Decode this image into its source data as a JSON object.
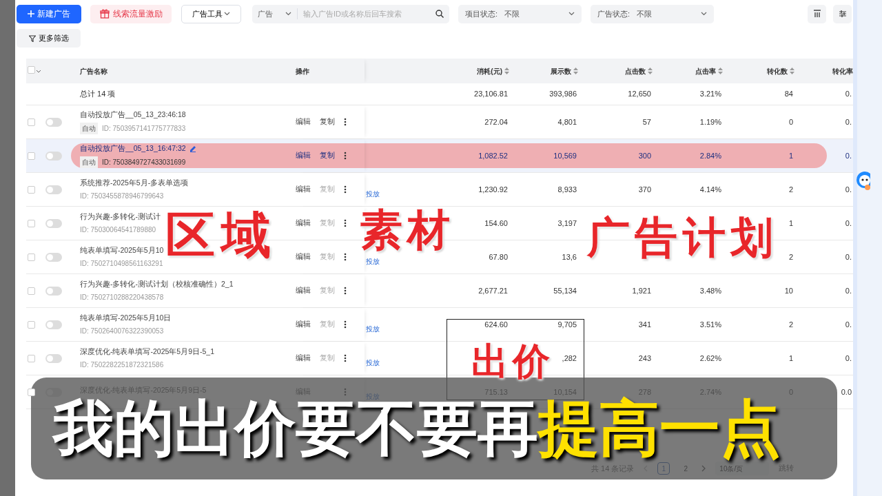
{
  "toolbar": {
    "new_button": "新建广告",
    "incentive_button": "线索流量激励",
    "tools_dropdown": "广告工具",
    "search": {
      "scope": "广告",
      "placeholder": "输入广告ID或名称后回车搜索"
    },
    "filters": [
      {
        "label": "项目状态:",
        "value": "不限"
      },
      {
        "label": "广告状态:",
        "value": "不限"
      }
    ],
    "more_filters": "更多筛选"
  },
  "table": {
    "select_all_checked": false,
    "columns": [
      {
        "label": "广告名称",
        "sortable": false
      },
      {
        "label": "操作",
        "sortable": false
      },
      {
        "label": "消耗(元)",
        "sortable": true
      },
      {
        "label": "展示数",
        "sortable": true
      },
      {
        "label": "点击数",
        "sortable": true
      },
      {
        "label": "点击率",
        "sortable": true
      },
      {
        "label": "转化数",
        "sortable": true
      },
      {
        "label": "转化率",
        "sortable": false
      }
    ],
    "total": {
      "label": "总计 14 项",
      "values": [
        "23,106.81",
        "393,986",
        "12,650",
        "3.21%",
        "84",
        "0."
      ]
    },
    "rows": [
      {
        "name": "自动投放广告__05_13_23:46:18",
        "tag": "自动",
        "id": "ID: 7503957141775777833",
        "selected": false,
        "checked": false,
        "on": false,
        "edit": "编辑",
        "copy": "复制",
        "copy_disabled": false,
        "values": {
          "cost": "272.04",
          "impressions": "4,801",
          "clicks": "57",
          "ctr": "1.19%",
          "conversions": "0",
          "conversion_rate": "0."
        }
      },
      {
        "name": "自动投放广告__05_13_16:47:32",
        "tag": "自动",
        "id": "ID: 7503849727433031699",
        "selected": true,
        "checked": false,
        "on": false,
        "edit": "编辑",
        "copy": "复制",
        "copy_disabled": false,
        "values": {
          "cost": "1,082.52",
          "impressions": "10,569",
          "clicks": "300",
          "ctr": "2.84%",
          "conversions": "1",
          "conversion_rate": "0."
        }
      },
      {
        "name": "系统推荐-2025年5月-多表单选项",
        "id": "ID: 7503455878946799643",
        "selected": false,
        "checked": false,
        "on": false,
        "edit": "编辑",
        "copy": "复制",
        "copy_disabled": true,
        "status": "投放",
        "values": {
          "cost": "1,230.92",
          "impressions": "8,933",
          "clicks": "370",
          "ctr": "4.14%",
          "conversions": "2",
          "conversion_rate": "0."
        }
      },
      {
        "name": "行为兴趣-多转化-测试计",
        "id": "ID: 75030064541789880",
        "selected": false,
        "checked": false,
        "on": false,
        "edit": "编辑",
        "copy": "复制",
        "copy_disabled": true,
        "values": {
          "cost": "154.60",
          "impressions": "3,197",
          "conversions": "1",
          "conversion_rate": "0."
        }
      },
      {
        "name": "纯表单填写-2025年5月10",
        "id": "ID: 7502710498561163291",
        "selected": false,
        "checked": false,
        "on": false,
        "edit": "编辑",
        "copy": "复制",
        "copy_disabled": true,
        "status": "投放",
        "values": {
          "cost": "67.80",
          "impressions": "13,6",
          "conversions": "2",
          "conversion_rate": "0."
        }
      },
      {
        "name": "行为兴趣-多转化-测试计划（校核准确性）2_1",
        "id": "ID: 7502710288220438578",
        "selected": false,
        "checked": false,
        "on": false,
        "edit": "编辑",
        "copy": "复制",
        "copy_disabled": true,
        "values": {
          "cost": "2,677.21",
          "impressions": "55,134",
          "clicks": "1,921",
          "ctr": "3.48%",
          "conversions": "10",
          "conversion_rate": "0."
        }
      },
      {
        "name": "纯表单填写-2025年5月10日",
        "id": "ID: 7502640076322390053",
        "selected": false,
        "checked": false,
        "on": false,
        "edit": "编辑",
        "copy": "复制",
        "copy_disabled": true,
        "status": "投放",
        "values": {
          "cost": "624.60",
          "impressions": "9,705",
          "clicks": "341",
          "ctr": "3.51%",
          "conversions": "2",
          "conversion_rate": "0."
        }
      },
      {
        "name": "深度优化-纯表单填写-2025年5月9日-5_1",
        "id": "ID: 7502282251872321586",
        "selected": false,
        "checked": false,
        "on": false,
        "edit": "编辑",
        "copy": "复制",
        "copy_disabled": true,
        "status": "投放",
        "values": {
          "impressions": ",282",
          "clicks": "243",
          "ctr": "2.62%",
          "conversions": "1",
          "conversion_rate": "0."
        }
      },
      {
        "name": "深度优化-纯表单填写-2025年5月9日-5",
        "selected": false,
        "checked": false,
        "on": false,
        "edit": "编辑",
        "status": "投放",
        "values": {
          "cost": "715.13",
          "impressions": "10,154",
          "clicks": "278",
          "ctr": "2.74%",
          "conversions": "0",
          "conversion_rate": "0.0"
        }
      }
    ]
  },
  "pagination": {
    "total": "共 14 条记录",
    "pages": [
      {
        "label": "1",
        "selected": true
      },
      {
        "label": "2",
        "selected": false
      }
    ],
    "page_size": "10条/页",
    "jump": "跳转"
  },
  "annotations": [
    {
      "text": "区域"
    },
    {
      "text": "素材"
    },
    {
      "text": "广告计划"
    },
    {
      "text": "出价"
    }
  ],
  "subtitle": [
    {
      "text": "我的出价要不要再",
      "emphasis": false
    },
    {
      "text": "提高一点",
      "emphasis": true
    }
  ]
}
